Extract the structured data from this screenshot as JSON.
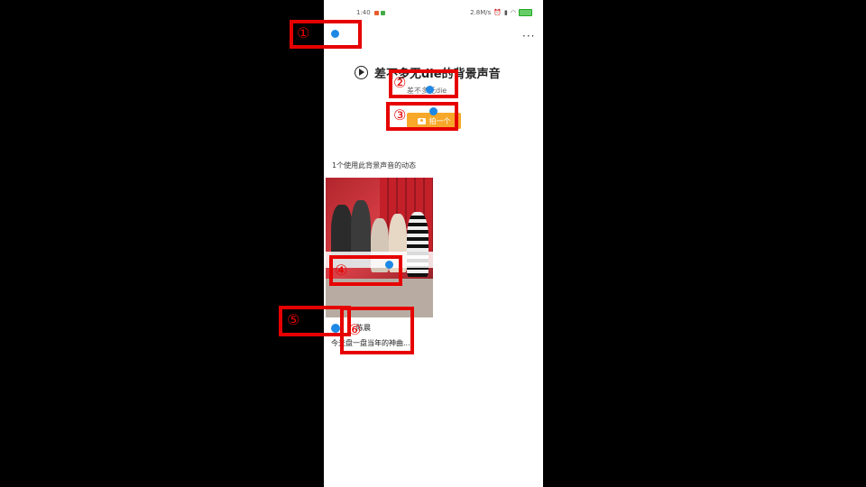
{
  "status_bar": {
    "time": "1:40",
    "network_speed": "2.8M/s",
    "icons": [
      "alarm-icon",
      "signal-icon",
      "wifi-icon",
      "battery-icon"
    ]
  },
  "header": {
    "more_label": "···"
  },
  "sound": {
    "title": "差不多无die的背景声音",
    "artist": "差不多无die",
    "shoot_label": "拍一个"
  },
  "section": {
    "title": "1个使用此背景声音的动态"
  },
  "post": {
    "author": "陈晨",
    "description": "今天盘一盘当年的神曲..."
  },
  "annotations": {
    "labels": [
      "①",
      "②",
      "③",
      "④",
      "⑤",
      "⑥"
    ],
    "color": "#e60000"
  },
  "colors": {
    "accent": "#f7a82a",
    "marker": "#1e88e5"
  }
}
